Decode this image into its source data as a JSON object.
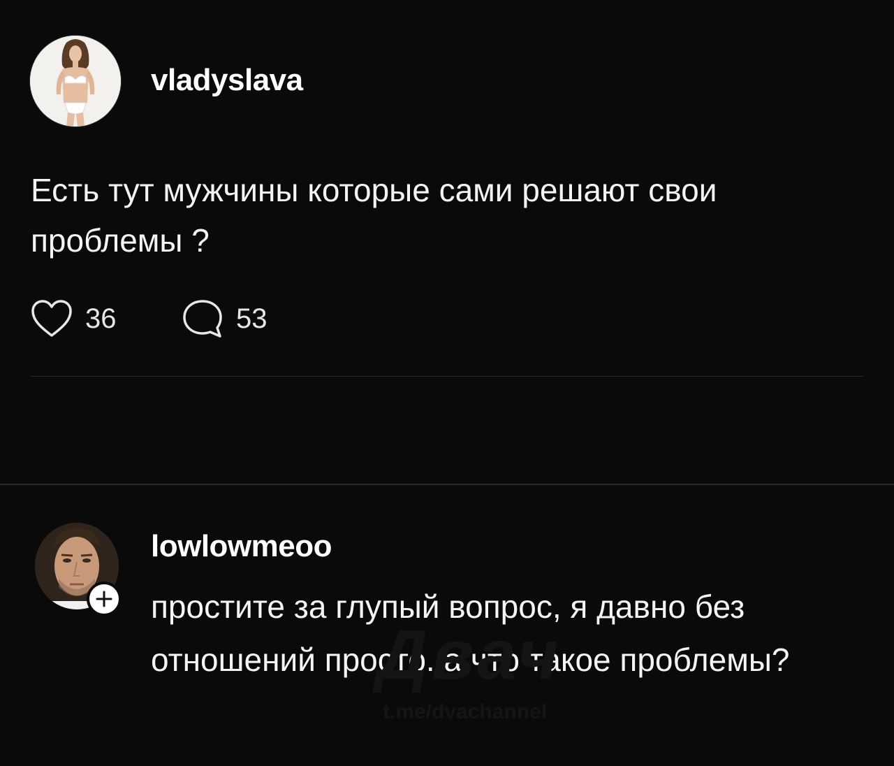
{
  "post": {
    "author": {
      "username": "vladyslava",
      "avatar_icon": "profile-photo-woman"
    },
    "text": "Есть тут мужчины которые сами решают свои проблемы ?",
    "likes": "36",
    "replies": "53",
    "like_icon": "heart-icon",
    "reply_icon": "speech-bubble-icon"
  },
  "comment": {
    "author": {
      "username": "lowlowmeoo",
      "avatar_icon": "profile-photo-man",
      "follow_icon": "plus-icon"
    },
    "text": "простите за глупый вопрос, я давно без отношений просто. а что такое проблемы?"
  },
  "watermark": {
    "logo": "Двач",
    "url": "t.me/dvachannel"
  },
  "colors": {
    "background": "#0a0a0a",
    "text": "#f4f4f4",
    "divider": "#2b2b2b"
  }
}
